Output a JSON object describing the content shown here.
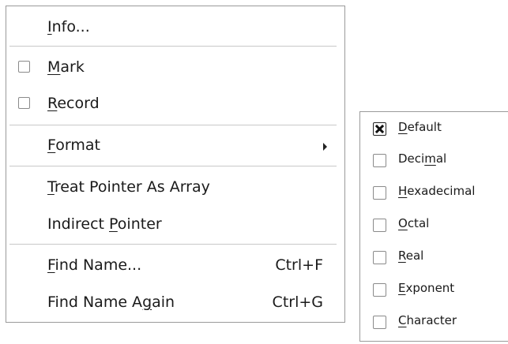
{
  "menu": {
    "items": [
      {
        "type": "item",
        "pre": "",
        "ul": "I",
        "post": "nfo...",
        "shortcut": ""
      },
      {
        "type": "check",
        "pre": "",
        "ul": "M",
        "post": "ark",
        "checked": false
      },
      {
        "type": "check",
        "pre": "",
        "ul": "R",
        "post": "ecord",
        "checked": false
      },
      {
        "type": "submenu",
        "pre": "",
        "ul": "F",
        "post": "ormat"
      },
      {
        "type": "item",
        "pre": "",
        "ul": "T",
        "post": "reat Pointer As Array",
        "shortcut": ""
      },
      {
        "type": "item",
        "pre": "Indirect ",
        "ul": "P",
        "post": "ointer",
        "shortcut": ""
      },
      {
        "type": "item",
        "pre": "",
        "ul": "F",
        "post": "ind Name...",
        "shortcut": "Ctrl+F"
      },
      {
        "type": "item",
        "pre": "Find Name A",
        "ul": "g",
        "post": "ain",
        "shortcut": "Ctrl+G"
      }
    ]
  },
  "submenu": {
    "items": [
      {
        "pre": "",
        "ul": "D",
        "post": "efault",
        "checked": true
      },
      {
        "pre": "Deci",
        "ul": "m",
        "post": "al",
        "checked": false
      },
      {
        "pre": "",
        "ul": "H",
        "post": "exadecimal",
        "checked": false
      },
      {
        "pre": "",
        "ul": "O",
        "post": "ctal",
        "checked": false
      },
      {
        "pre": "",
        "ul": "R",
        "post": "eal",
        "checked": false
      },
      {
        "pre": "",
        "ul": "E",
        "post": "xponent",
        "checked": false
      },
      {
        "pre": "",
        "ul": "C",
        "post": "haracter",
        "checked": false
      }
    ]
  }
}
